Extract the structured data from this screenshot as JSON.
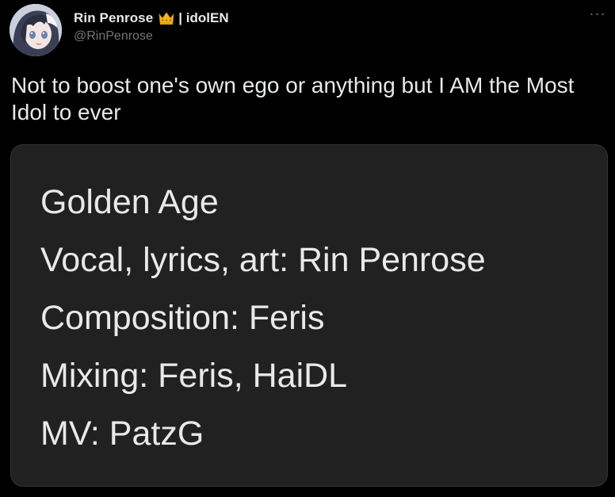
{
  "author": {
    "display_name": "Rin Penrose",
    "name_suffix": "| idolEN",
    "handle": "@RinPenrose",
    "badge_icon": "crown-icon"
  },
  "menu": {
    "more_label": "···"
  },
  "tweet": {
    "text": "Not to boost one's own ego or anything but I AM the Most Idol to ever"
  },
  "media": {
    "lines": [
      "Golden Age",
      "Vocal, lyrics, art: Rin Penrose",
      "Composition: Feris",
      "Mixing: Feris, HaiDL",
      "MV: PatzG"
    ]
  },
  "colors": {
    "background": "#000000",
    "text": "#e7e9ea",
    "secondary": "#71767b",
    "media_bg": "#212121",
    "crown": "#f5b70a"
  }
}
